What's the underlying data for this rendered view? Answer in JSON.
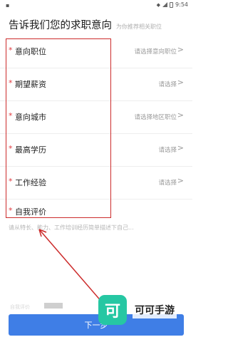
{
  "statusbar": {
    "left_icon": "notification-icon",
    "time": "9:54"
  },
  "header": {
    "title": "告诉我们您的求职意向",
    "subtitle": "为你推荐相关职位"
  },
  "rows": [
    {
      "star": "*",
      "label": "意向职位",
      "value": "请选择意向职位",
      "chevron": ">"
    },
    {
      "star": "*",
      "label": "期望薪资",
      "value": "请选择",
      "chevron": ">"
    },
    {
      "star": "*",
      "label": "意向城市",
      "value": "请选择地区职位",
      "chevron": ">"
    },
    {
      "star": "*",
      "label": "最高学历",
      "value": "请选择",
      "chevron": ">"
    },
    {
      "star": "*",
      "label": "工作经验",
      "value": "请选择",
      "chevron": ">"
    }
  ],
  "evaluation": {
    "star": "*",
    "label": "自我评价",
    "placeholder": "请从特长、能力、工作培训经历简单描述下自己..."
  },
  "faded_text": "自我评价",
  "next_button": {
    "label": "下一步"
  },
  "watermark": {
    "logo_char": "可",
    "text": "可可手游"
  },
  "colors": {
    "accent": "#3f7ee6",
    "required": "#e0393e",
    "annotation": "#cc2b2b",
    "watermark": "#26c7a3"
  }
}
